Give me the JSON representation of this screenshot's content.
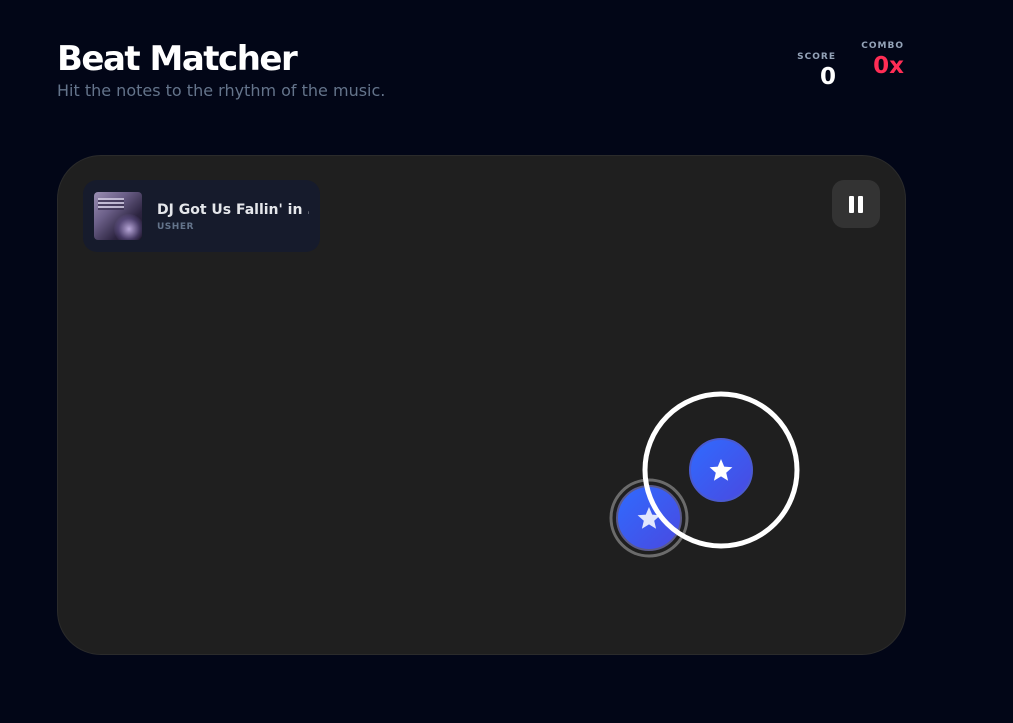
{
  "header": {
    "title": "Beat Matcher",
    "subtitle": "Hit the notes to the rhythm of the music."
  },
  "stats": {
    "score_label": "SCORE",
    "score_value": "0",
    "combo_label": "COMBO",
    "combo_value": "0x"
  },
  "now_playing": {
    "title": "DJ Got Us Fallin' in ...",
    "artist": "USHER"
  },
  "colors": {
    "background": "#020617",
    "stage": "#1f1f1f",
    "note": "#3b5bff",
    "combo": "#ff2d55",
    "approach_ring": "#ffffff"
  },
  "controls": {
    "pause_icon": "pause-icon"
  },
  "notes": [
    {
      "icon": "star-icon",
      "state": "active-with-approach-ring"
    },
    {
      "icon": "star-icon",
      "state": "fading"
    }
  ]
}
